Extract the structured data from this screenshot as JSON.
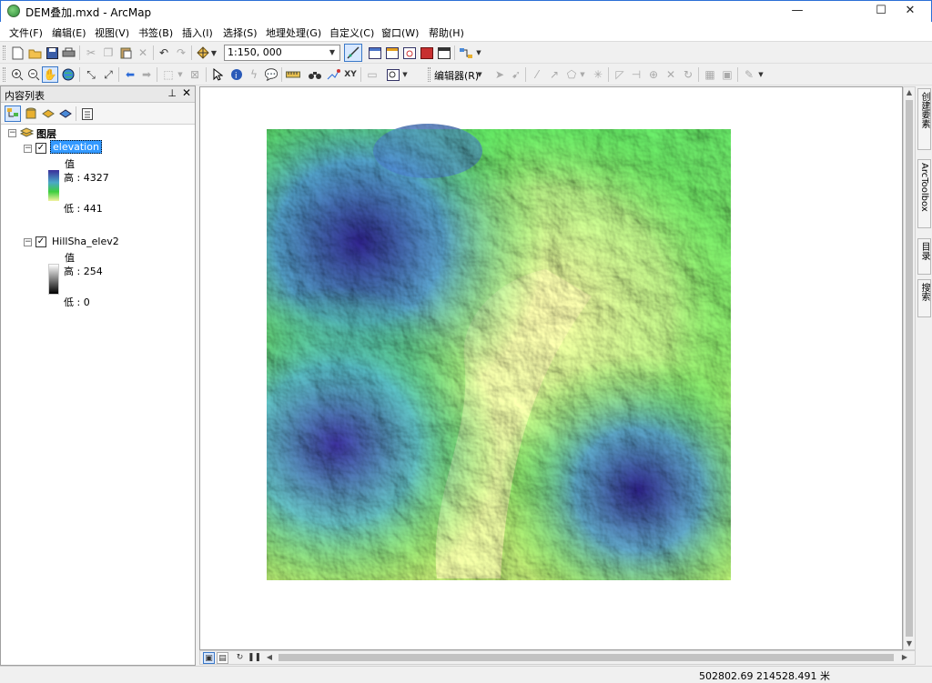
{
  "window": {
    "title": "DEM叠加.mxd - ArcMap",
    "minimize": "—",
    "maximize": "☐",
    "close": "✕"
  },
  "menus": [
    "文件(F)",
    "编辑(E)",
    "视图(V)",
    "书签(B)",
    "插入(I)",
    "选择(S)",
    "地理处理(G)",
    "自定义(C)",
    "窗口(W)",
    "帮助(H)"
  ],
  "toolbar": {
    "scale": "1:150, 000",
    "editor_label": "编辑器(R)"
  },
  "toc": {
    "title": "内容列表",
    "root_label": "图层",
    "layers": [
      {
        "name": "elevation",
        "value_label": "值",
        "high": "高 : 4327",
        "low": "低 : 441"
      },
      {
        "name": "HillSha_elev2",
        "value_label": "值",
        "high": "高 : 254",
        "low": "低 : 0"
      }
    ]
  },
  "side_tabs": [
    "创建要素",
    "ArcToolbox",
    "目录",
    "搜索"
  ],
  "status": {
    "coords": "502802.69  214528.491 米"
  },
  "colors": {
    "elev_high": "#3a2f9a",
    "elev_mid": "#3ecf3e",
    "elev_low": "#f2f2a0",
    "hill_high": "#ffffff",
    "hill_low": "#000000",
    "selection": "#3399ff"
  }
}
